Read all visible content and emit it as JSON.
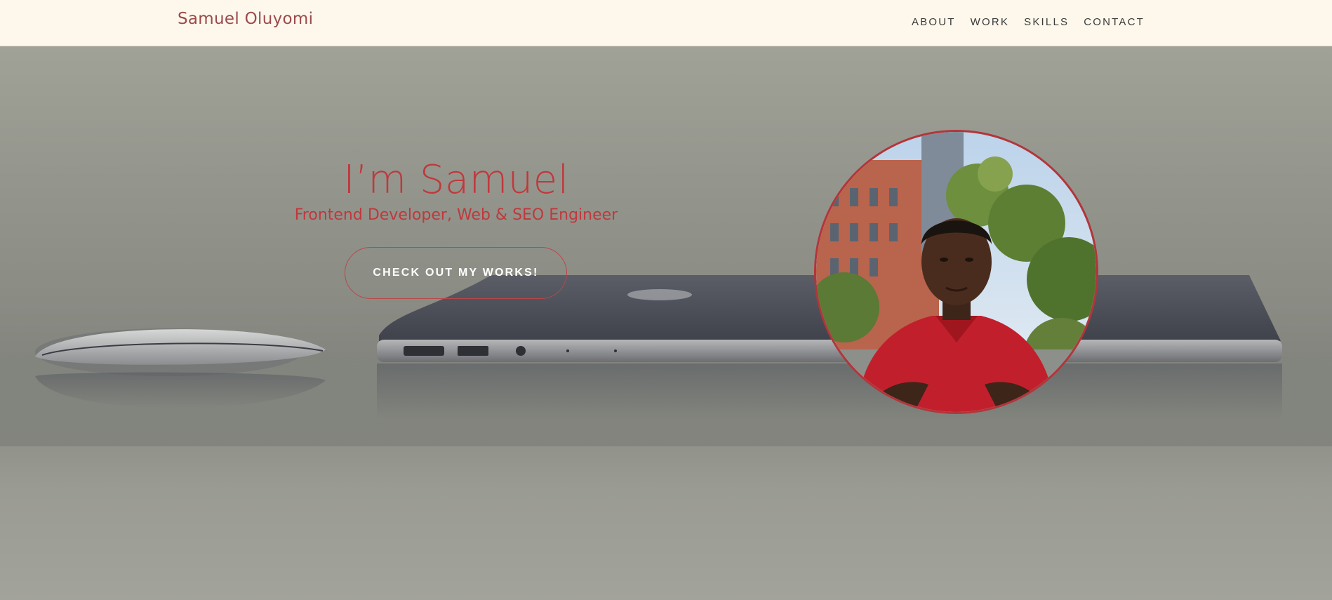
{
  "header": {
    "brand": "Samuel Oluyomi",
    "nav": [
      {
        "label": "ABOUT"
      },
      {
        "label": "WORK"
      },
      {
        "label": "SKILLS"
      },
      {
        "label": "CONTACT"
      }
    ]
  },
  "hero": {
    "title": "I’m Samuel",
    "subtitle": "Frontend Developer, Web & SEO Engineer",
    "cta_label": "CHECK OUT MY WORKS!",
    "background_image": "desk-laptop-mouse-image",
    "portrait_image": "profile-photo"
  },
  "colors": {
    "accent": "#c0383c",
    "header_bg": "#fef8ec",
    "brand_text": "#9c4a4c",
    "nav_text": "#3a3a3a"
  }
}
